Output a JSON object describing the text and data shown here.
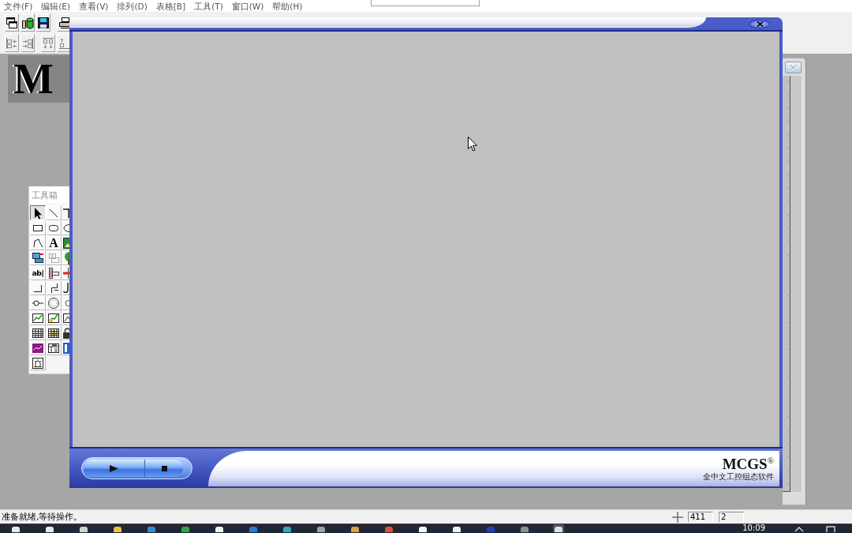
{
  "menu_bar": {
    "items": [
      "文件(F)",
      "编辑(E)",
      "查看(V)",
      "排列(D)",
      "表格[B]",
      "工具(T)",
      "窗口(W)",
      "帮助(H)"
    ]
  },
  "logo_banner": {
    "text": "M"
  },
  "toolbox": {
    "title": "工具箱",
    "tools": [
      {
        "selected": true
      },
      {
        "selected": false
      },
      {
        "selected": false
      },
      {
        "selected": false
      },
      {
        "selected": false
      },
      {
        "selected": false
      },
      {
        "selected": false
      },
      {
        "selected": false,
        "label": "A"
      },
      {
        "selected": false
      },
      {
        "selected": false
      },
      {
        "selected": false
      },
      {
        "selected": false
      },
      {
        "selected": false,
        "label": "ab|"
      },
      {
        "selected": false
      },
      {
        "selected": false
      },
      {
        "selected": false
      },
      {
        "selected": false
      },
      {
        "selected": false
      },
      {
        "selected": false
      },
      {
        "selected": false
      },
      {
        "selected": false
      },
      {
        "selected": false
      },
      {
        "selected": false
      },
      {
        "selected": false
      },
      {
        "selected": false
      },
      {
        "selected": false
      },
      {
        "selected": false
      },
      {
        "selected": false
      },
      {
        "selected": false
      },
      {
        "selected": false
      },
      {
        "selected": false
      }
    ]
  },
  "run_window": {
    "logo": "MCGS$^{®}$",
    "tagline": "全中文工控组态软件"
  },
  "status_bar": {
    "message": "准备就绪,等待操作。",
    "fields": [
      "411",
      "2"
    ]
  },
  "taskbar": {
    "clock": "10:09"
  }
}
